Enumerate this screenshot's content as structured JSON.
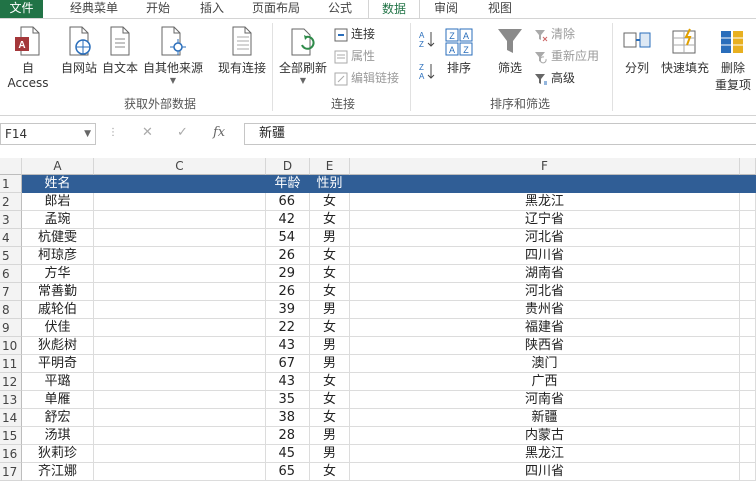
{
  "tabs": [
    {
      "label": "文件",
      "key": "file"
    },
    {
      "label": "经典菜单"
    },
    {
      "label": "开始"
    },
    {
      "label": "插入"
    },
    {
      "label": "页面布局"
    },
    {
      "label": "公式"
    },
    {
      "label": "数据",
      "key": "active"
    },
    {
      "label": "审阅"
    },
    {
      "label": "视图"
    }
  ],
  "ribbon": {
    "external": {
      "access": "自 Access",
      "web": "自网站",
      "text": "自文本",
      "other": "自其他来源",
      "existing": "现有连接",
      "group": "获取外部数据"
    },
    "connections": {
      "refresh": "全部刷新",
      "connections": "连接",
      "properties": "属性",
      "edit_links": "编辑链接",
      "group": "连接"
    },
    "sort_filter": {
      "sort": "排序",
      "filter": "筛选",
      "clear": "清除",
      "reapply": "重新应用",
      "advanced": "高级",
      "group": "排序和筛选"
    },
    "tools": {
      "split": "分列",
      "flash_fill": "快速填充",
      "remove_dup_1": "删除",
      "remove_dup_2": "重复项"
    }
  },
  "formula_bar": {
    "name_box": "F14",
    "value": "新疆"
  },
  "columns": [
    "A",
    "C",
    "D",
    "E",
    "F"
  ],
  "row_numbers": [
    "1",
    "2",
    "3",
    "4",
    "5",
    "6",
    "7",
    "8",
    "9",
    "10",
    "11",
    "12",
    "13",
    "14",
    "15",
    "16",
    "17"
  ],
  "header_row": {
    "name": "姓名",
    "age": "年龄",
    "gender": "性别"
  },
  "rows": [
    {
      "name": "郎岩",
      "age": "66",
      "gender": "女",
      "province": "黑龙江"
    },
    {
      "name": "孟琬",
      "age": "42",
      "gender": "女",
      "province": "辽宁省"
    },
    {
      "name": "杭健雯",
      "age": "54",
      "gender": "男",
      "province": "河北省"
    },
    {
      "name": "柯琼彦",
      "age": "26",
      "gender": "女",
      "province": "四川省"
    },
    {
      "name": "方华",
      "age": "29",
      "gender": "女",
      "province": "湖南省"
    },
    {
      "name": "常善勤",
      "age": "26",
      "gender": "女",
      "province": "河北省"
    },
    {
      "name": "戚轮伯",
      "age": "39",
      "gender": "男",
      "province": "贵州省"
    },
    {
      "name": "伏佳",
      "age": "22",
      "gender": "女",
      "province": "福建省"
    },
    {
      "name": "狄彪树",
      "age": "43",
      "gender": "男",
      "province": "陕西省"
    },
    {
      "name": "平明奇",
      "age": "67",
      "gender": "男",
      "province": "澳门"
    },
    {
      "name": "平璐",
      "age": "43",
      "gender": "女",
      "province": "广西"
    },
    {
      "name": "单雁",
      "age": "35",
      "gender": "女",
      "province": "河南省"
    },
    {
      "name": "舒宏",
      "age": "38",
      "gender": "女",
      "province": "新疆"
    },
    {
      "name": "汤琪",
      "age": "28",
      "gender": "男",
      "province": "内蒙古"
    },
    {
      "name": "狄莉珍",
      "age": "45",
      "gender": "男",
      "province": "黑龙江"
    },
    {
      "name": "齐江娜",
      "age": "65",
      "gender": "女",
      "province": "四川省"
    }
  ],
  "colors": {
    "accent": "#217346",
    "header_fill": "#305e96"
  }
}
